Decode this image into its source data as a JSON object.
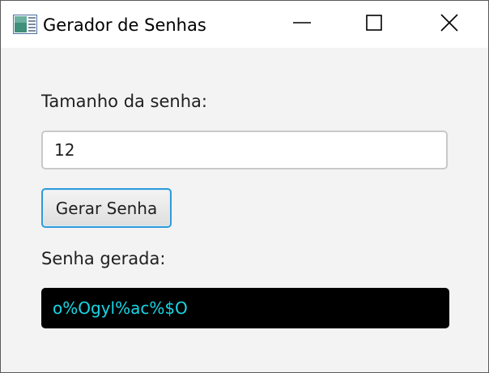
{
  "window": {
    "title": "Gerador de Senhas",
    "icons": {
      "app": "app-icon",
      "minimize": "minimize-icon",
      "maximize": "maximize-icon",
      "close": "close-icon"
    }
  },
  "form": {
    "size_label": "Tamanho da senha:",
    "size_value": "12",
    "generate_button": "Gerar Senha",
    "result_label": "Senha gerada:",
    "result_value": "o%Ogyl%ac%$O"
  },
  "colors": {
    "output_background": "#000000",
    "output_text": "#19d6e6",
    "focus_border": "#2f9bd8"
  }
}
